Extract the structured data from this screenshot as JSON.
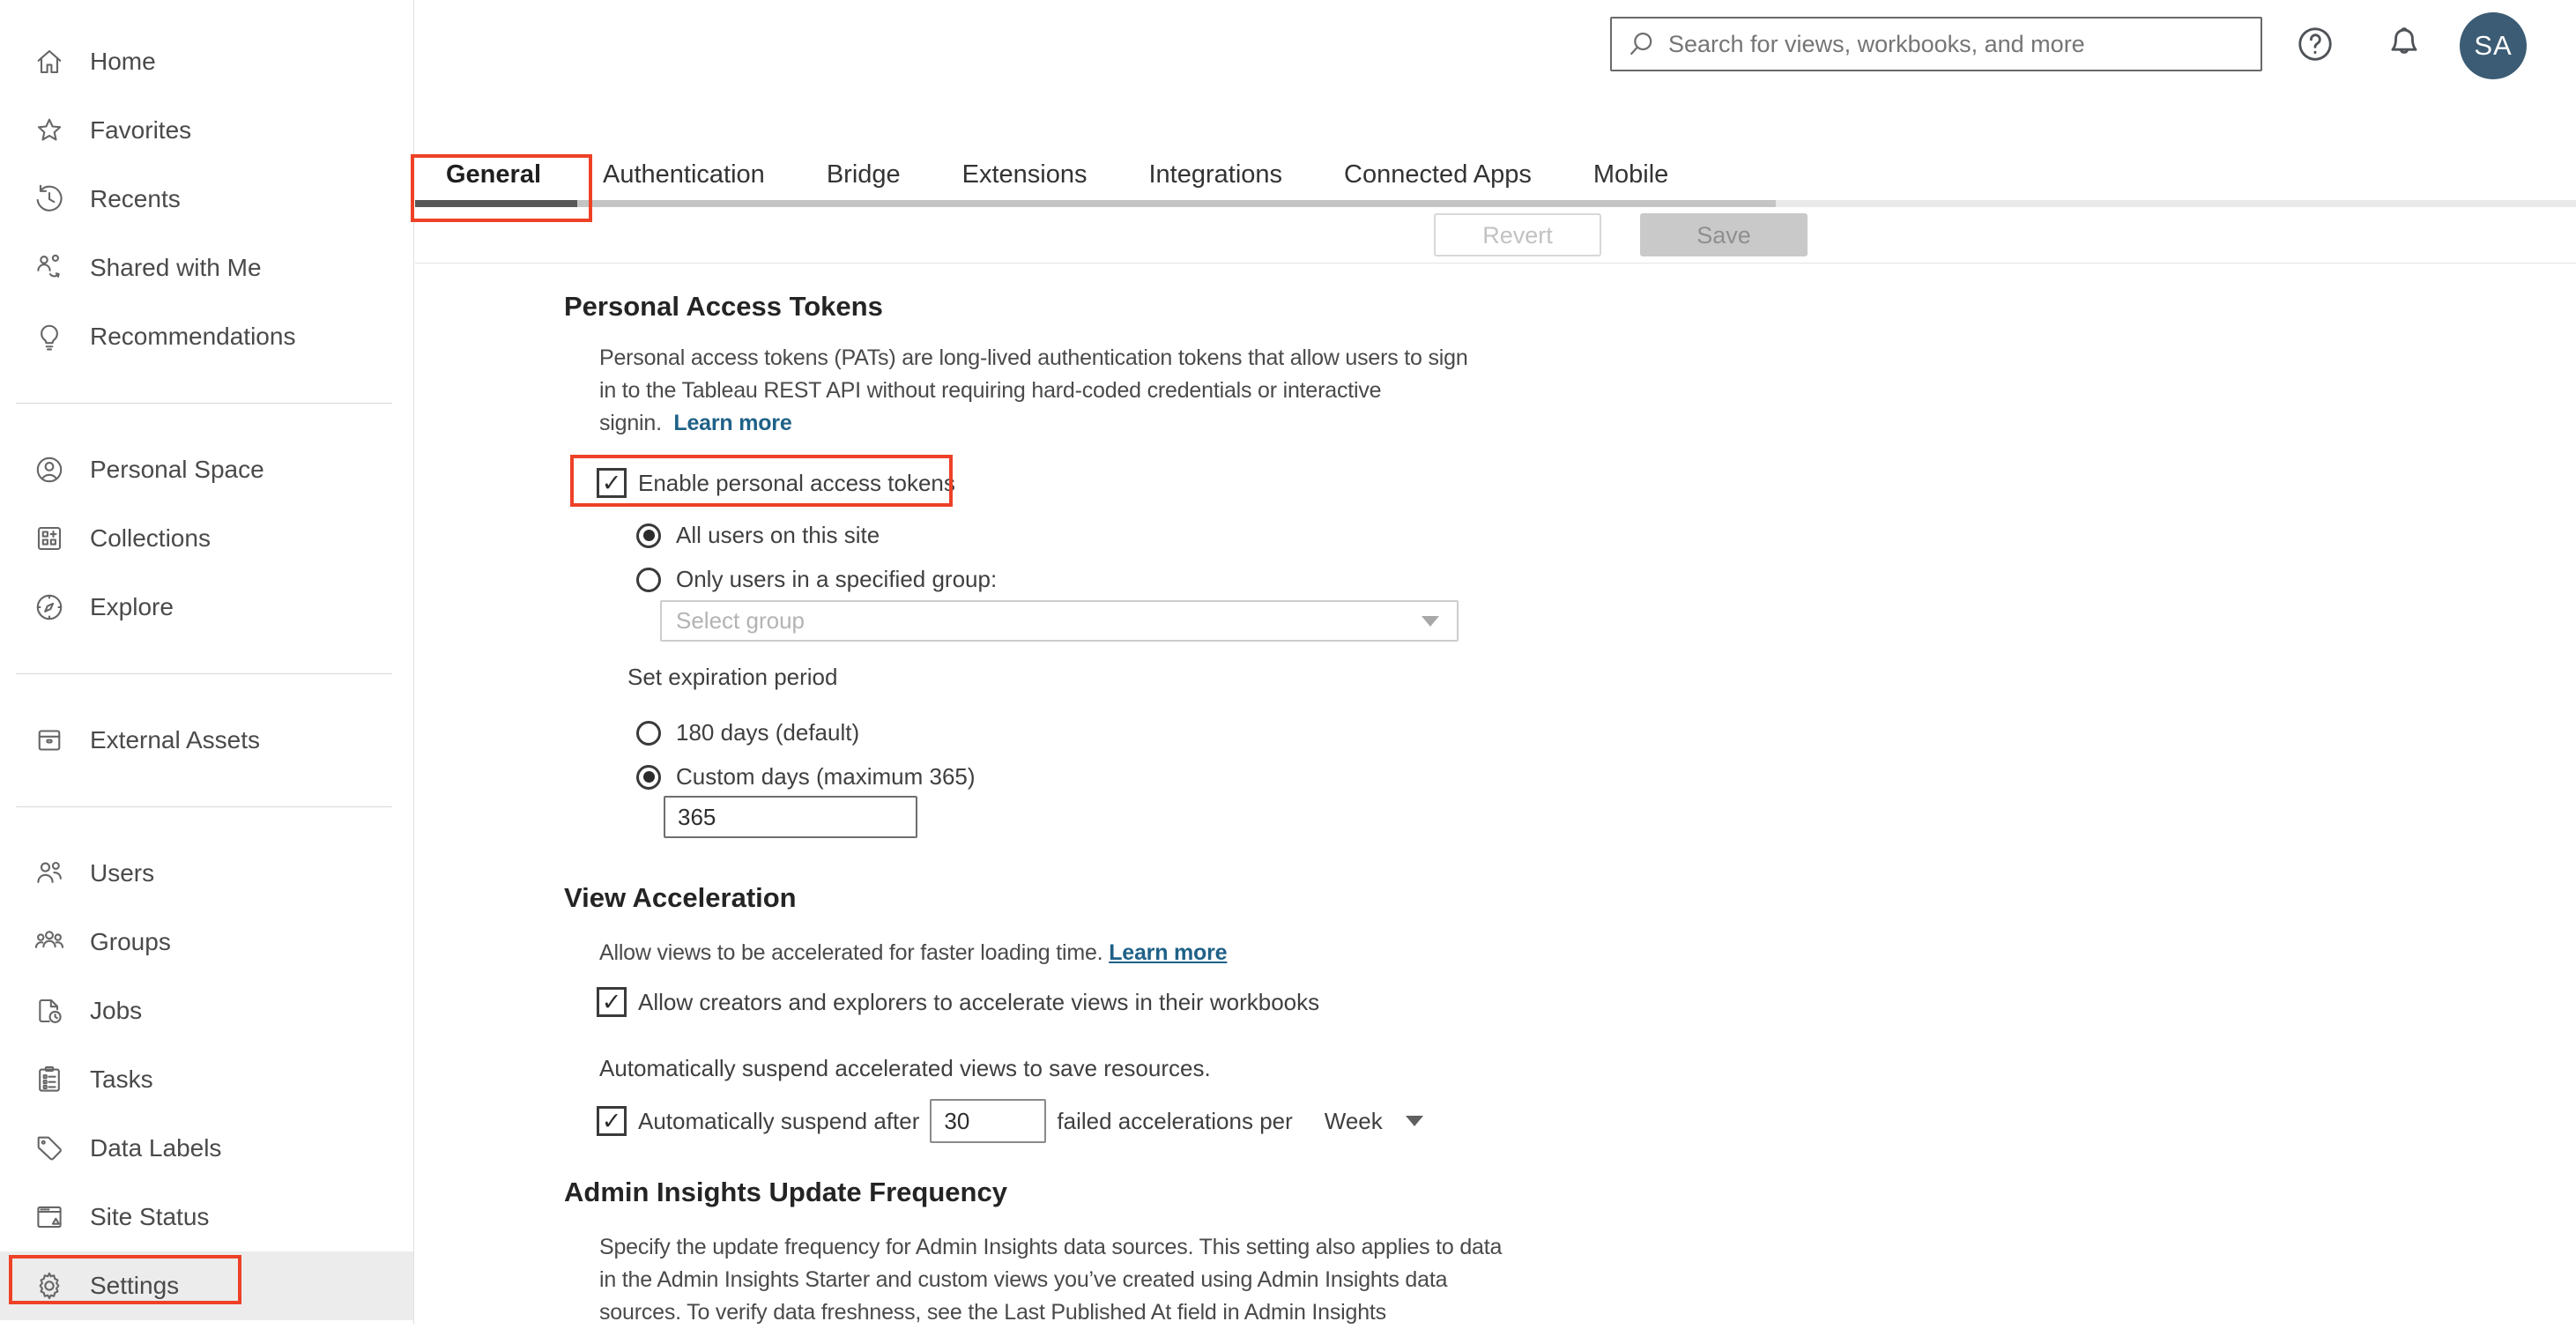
{
  "topbar": {
    "search_placeholder": "Search for views, workbooks, and more",
    "avatar_initials": "SA"
  },
  "sidebar": {
    "sections": [
      {
        "items": [
          {
            "icon": "home-icon",
            "label": "Home"
          },
          {
            "icon": "star-icon",
            "label": "Favorites"
          },
          {
            "icon": "recents-icon",
            "label": "Recents"
          },
          {
            "icon": "shared-icon",
            "label": "Shared with Me"
          },
          {
            "icon": "lightbulb-icon",
            "label": "Recommendations"
          }
        ]
      },
      {
        "items": [
          {
            "icon": "person-icon",
            "label": "Personal Space"
          },
          {
            "icon": "collections-icon",
            "label": "Collections"
          },
          {
            "icon": "explore-icon",
            "label": "Explore"
          }
        ]
      },
      {
        "items": [
          {
            "icon": "external-assets-icon",
            "label": "External Assets"
          }
        ]
      },
      {
        "items": [
          {
            "icon": "users-icon",
            "label": "Users"
          },
          {
            "icon": "groups-icon",
            "label": "Groups"
          },
          {
            "icon": "jobs-icon",
            "label": "Jobs"
          },
          {
            "icon": "tasks-icon",
            "label": "Tasks"
          },
          {
            "icon": "tag-icon",
            "label": "Data Labels"
          },
          {
            "icon": "site-status-icon",
            "label": "Site Status"
          },
          {
            "icon": "gear-icon",
            "label": "Settings",
            "active": true
          }
        ]
      }
    ]
  },
  "tabs": {
    "items": [
      {
        "label": "General",
        "active": true
      },
      {
        "label": "Authentication"
      },
      {
        "label": "Bridge"
      },
      {
        "label": "Extensions"
      },
      {
        "label": "Integrations"
      },
      {
        "label": "Connected Apps"
      },
      {
        "label": "Mobile"
      }
    ]
  },
  "toolbar": {
    "revert_label": "Revert",
    "save_label": "Save"
  },
  "pat": {
    "heading": "Personal Access Tokens",
    "description": "Personal access tokens (PATs) are long-lived authentication tokens that allow users to sign in to the Tableau REST API without requiring hard-coded credentials or interactive signin.",
    "learn_more": "Learn more",
    "enable_label": "Enable personal access tokens",
    "radio_all_users": "All users on this site",
    "radio_specified_group": "Only users in a specified group:",
    "group_placeholder": "Select group",
    "expiration_label": "Set expiration period",
    "radio_default_days": "180 days (default)",
    "radio_custom_days": "Custom days (maximum 365)",
    "custom_days_value": "365"
  },
  "view_acceleration": {
    "heading": "View Acceleration",
    "description": "Allow views to be accelerated for faster loading time.",
    "learn_more": "Learn more",
    "allow_label": "Allow creators and explorers to accelerate views in their workbooks",
    "suspend_description": "Automatically suspend accelerated views to save resources.",
    "suspend_prefix": "Automatically suspend after",
    "suspend_value": "30",
    "suspend_suffix": "failed accelerations per",
    "suspend_period": "Week"
  },
  "admin_insights": {
    "heading": "Admin Insights Update Frequency",
    "description": "Specify the update frequency for Admin Insights data sources. This setting also applies to data in the Admin Insights Starter and custom views you’ve created using Admin Insights data sources. To verify data freshness, see the Last Published At field in Admin Insights"
  },
  "colors": {
    "annotation_red": "#ee4127",
    "link_blue": "#1f6188",
    "avatar_bg": "#3b5c74"
  }
}
